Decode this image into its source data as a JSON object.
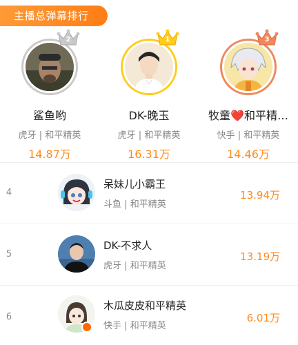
{
  "header": {
    "title": "主播总弹幕排行"
  },
  "podium": [
    {
      "rank": "2",
      "name": "鲨鱼哟",
      "platform": "虎牙",
      "game": "和平精英",
      "score": "14.87万",
      "separator": "|"
    },
    {
      "rank": "1",
      "name": "DK-晚玉",
      "platform": "虎牙",
      "game": "和平精英",
      "score": "16.31万",
      "separator": "|"
    },
    {
      "rank": "3",
      "name": "牧童❤️和平精…",
      "platform": "快手",
      "game": "和平精英",
      "score": "14.46万",
      "separator": "|"
    }
  ],
  "list": [
    {
      "rank": "4",
      "name": "呆妹儿小霸王",
      "platform": "斗鱼",
      "game": "和平精英",
      "score": "13.94万",
      "separator": "|"
    },
    {
      "rank": "5",
      "name": "DK-不求人",
      "platform": "虎牙",
      "game": "和平精英",
      "score": "13.19万",
      "separator": "|"
    },
    {
      "rank": "6",
      "name": "木瓜皮皮和平精英",
      "platform": "快手",
      "game": "和平精英",
      "score": "6.01万",
      "separator": "|"
    }
  ],
  "colors": {
    "accent": "#ff8a1d",
    "gold": "#ffcc1c",
    "silver": "#c9c9c9",
    "bronze": "#f0875e"
  }
}
